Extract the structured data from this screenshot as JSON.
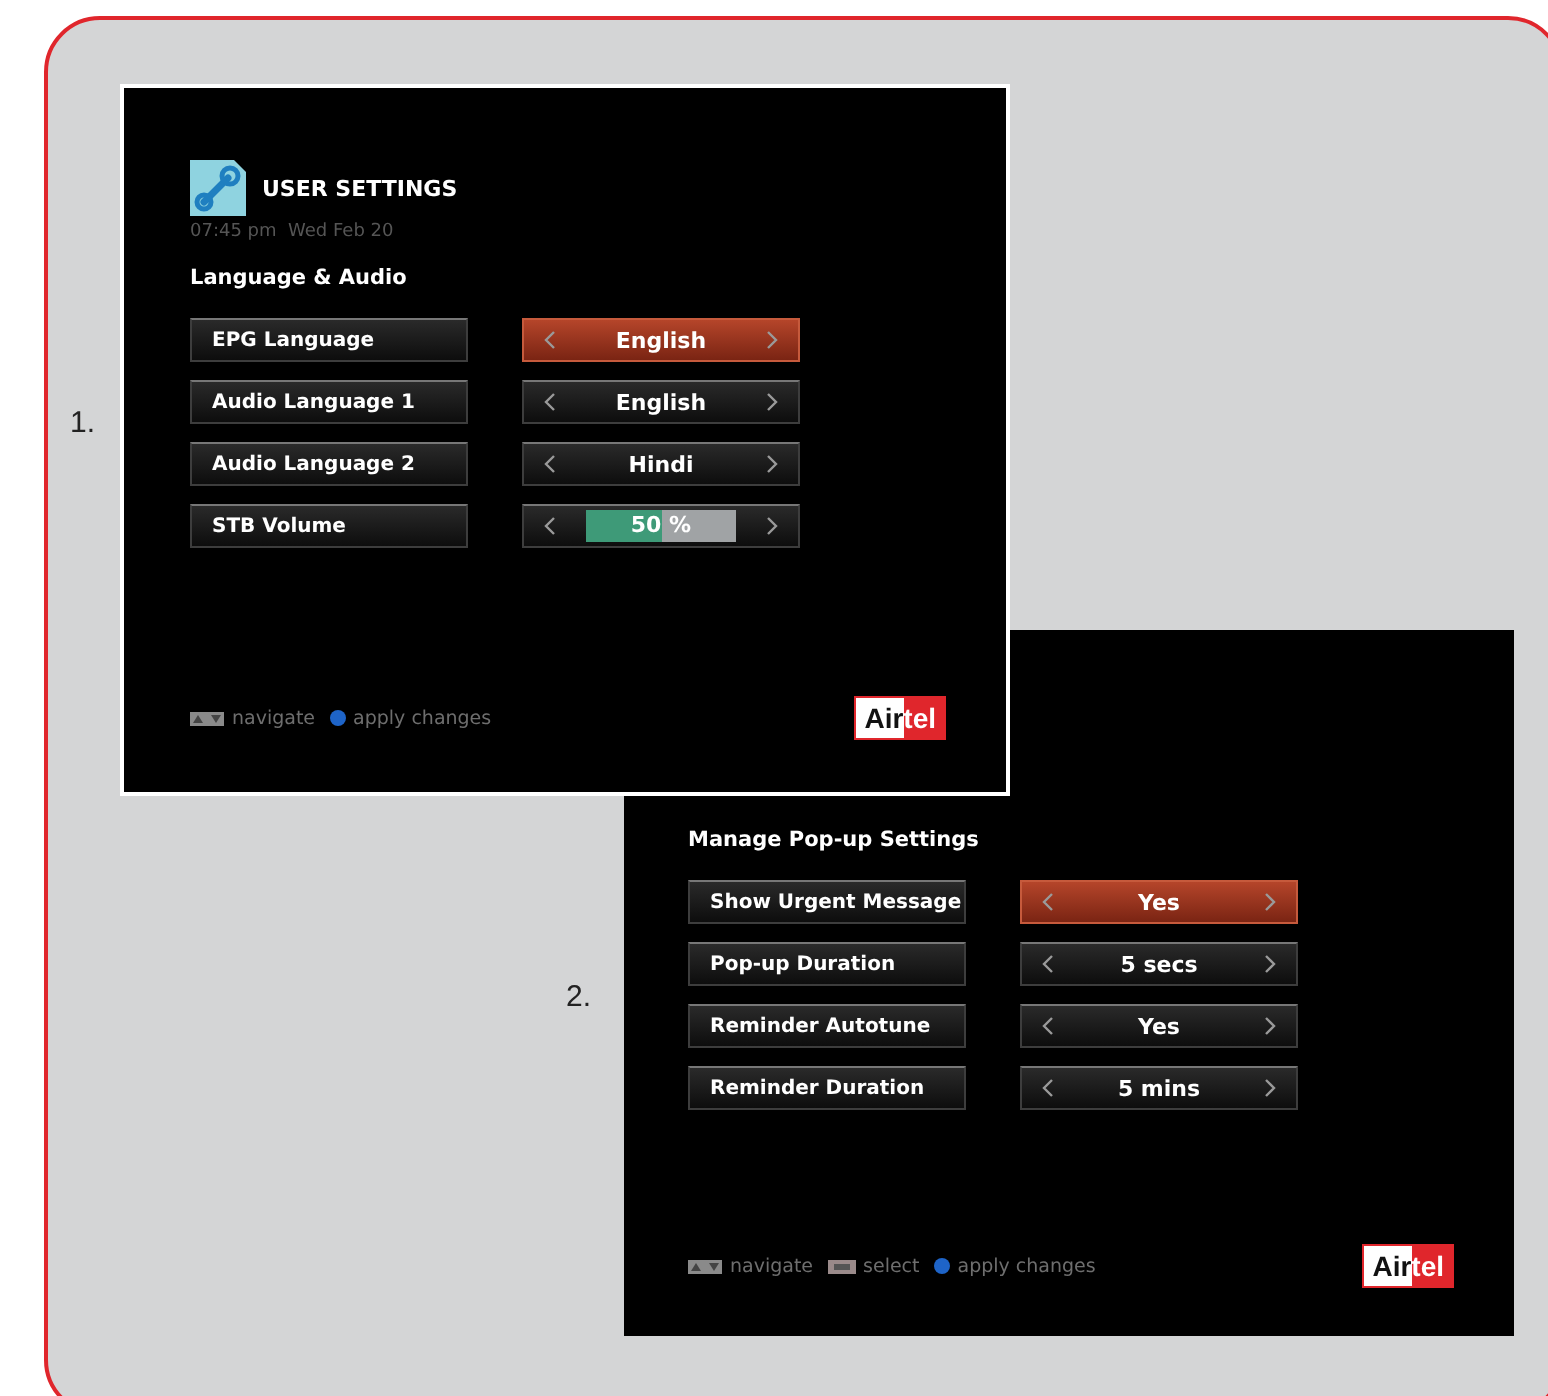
{
  "panels": [
    {
      "number": "1.",
      "title": "USER SETTINGS",
      "datetime": "07:45 pm  Wed Feb 20",
      "section": "Language & Audio",
      "rows": [
        {
          "label": "EPG Language",
          "kind": "option",
          "value": "English",
          "selected": true
        },
        {
          "label": "Audio Language 1",
          "kind": "option",
          "value": "English",
          "selected": false
        },
        {
          "label": "Audio Language 2",
          "kind": "option",
          "value": "Hindi",
          "selected": false
        },
        {
          "label": "STB Volume",
          "kind": "slider",
          "level": 0.5,
          "reading": "50 %",
          "selected": false
        }
      ],
      "hints": [
        {
          "kind": "navigate",
          "text": "navigate"
        },
        {
          "kind": "apply",
          "text": "apply changes"
        }
      ],
      "logo": [
        "Air",
        "tel"
      ]
    },
    {
      "number": "2.",
      "section": "Manage Pop-up Settings",
      "rows": [
        {
          "label": "Show Urgent Message",
          "kind": "option",
          "value": "Yes",
          "selected": true
        },
        {
          "label": "Pop-up Duration",
          "kind": "option",
          "value": "5 secs",
          "selected": false
        },
        {
          "label": "Reminder Autotune",
          "kind": "option",
          "value": "Yes",
          "selected": false
        },
        {
          "label": "Reminder Duration",
          "kind": "option",
          "value": "5 mins",
          "selected": false
        }
      ],
      "hints": [
        {
          "kind": "navigate",
          "text": "navigate"
        },
        {
          "kind": "select",
          "text": "select"
        },
        {
          "kind": "apply",
          "text": "apply changes"
        }
      ],
      "logo": [
        "Air",
        "tel"
      ]
    }
  ]
}
